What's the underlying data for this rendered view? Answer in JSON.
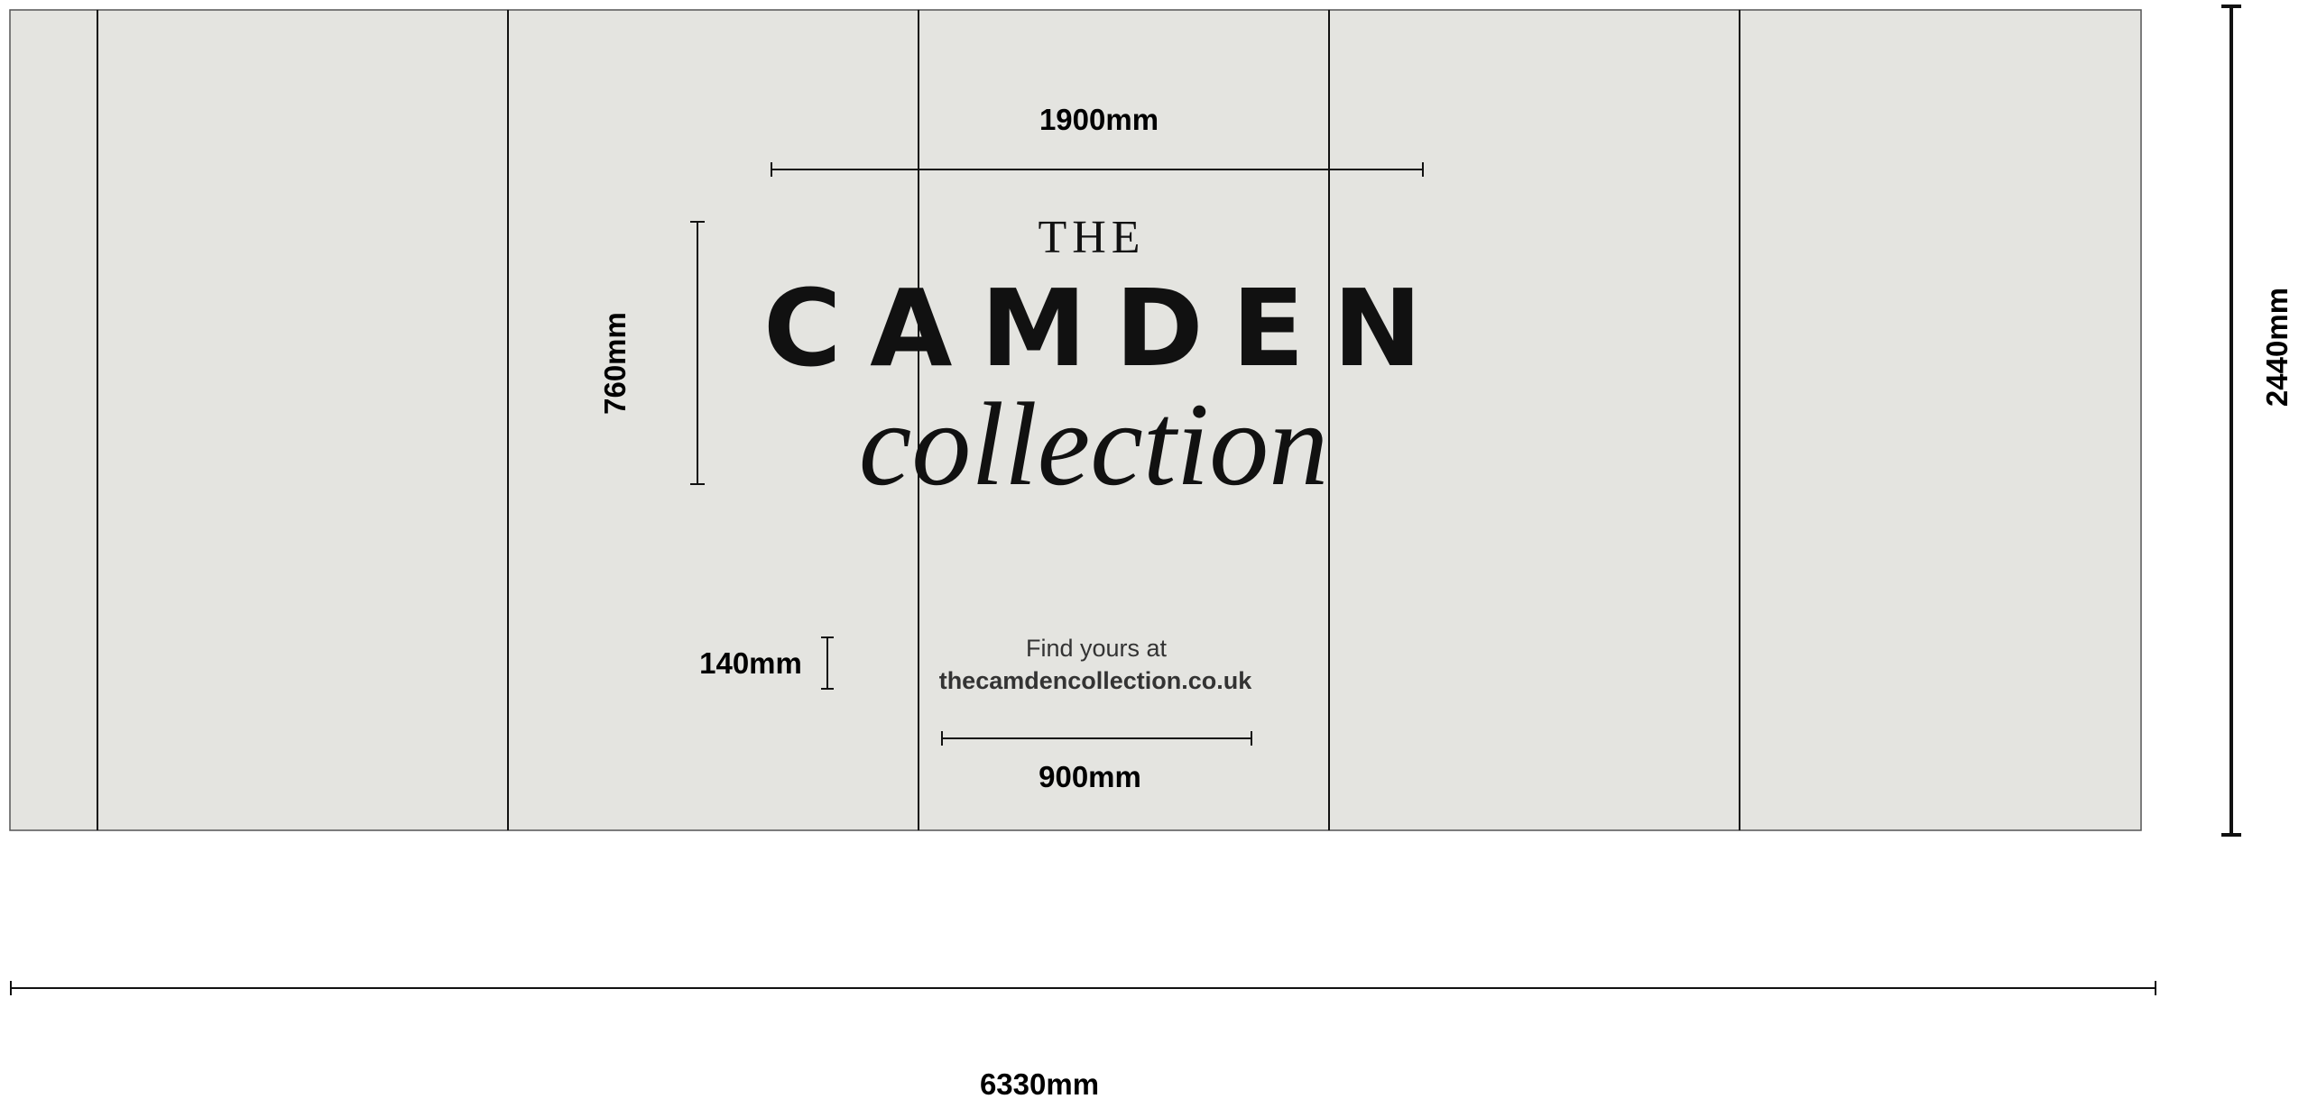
{
  "logo": {
    "line1": "THE",
    "line2": "CAMDEN",
    "line3": "collection"
  },
  "cta": {
    "line1": "Find yours at",
    "url": "thecamdencollection.co.uk"
  },
  "dimensions": {
    "logo_width": "1900mm",
    "logo_height": "760mm",
    "text_height": "140mm",
    "url_width": "900mm",
    "total_height": "2440mm",
    "total_width": "6330mm"
  },
  "colors": {
    "panel_fill": "#e4e4e0",
    "ink": "#111111",
    "cta_text": "#333333",
    "background": "#ffffff"
  }
}
